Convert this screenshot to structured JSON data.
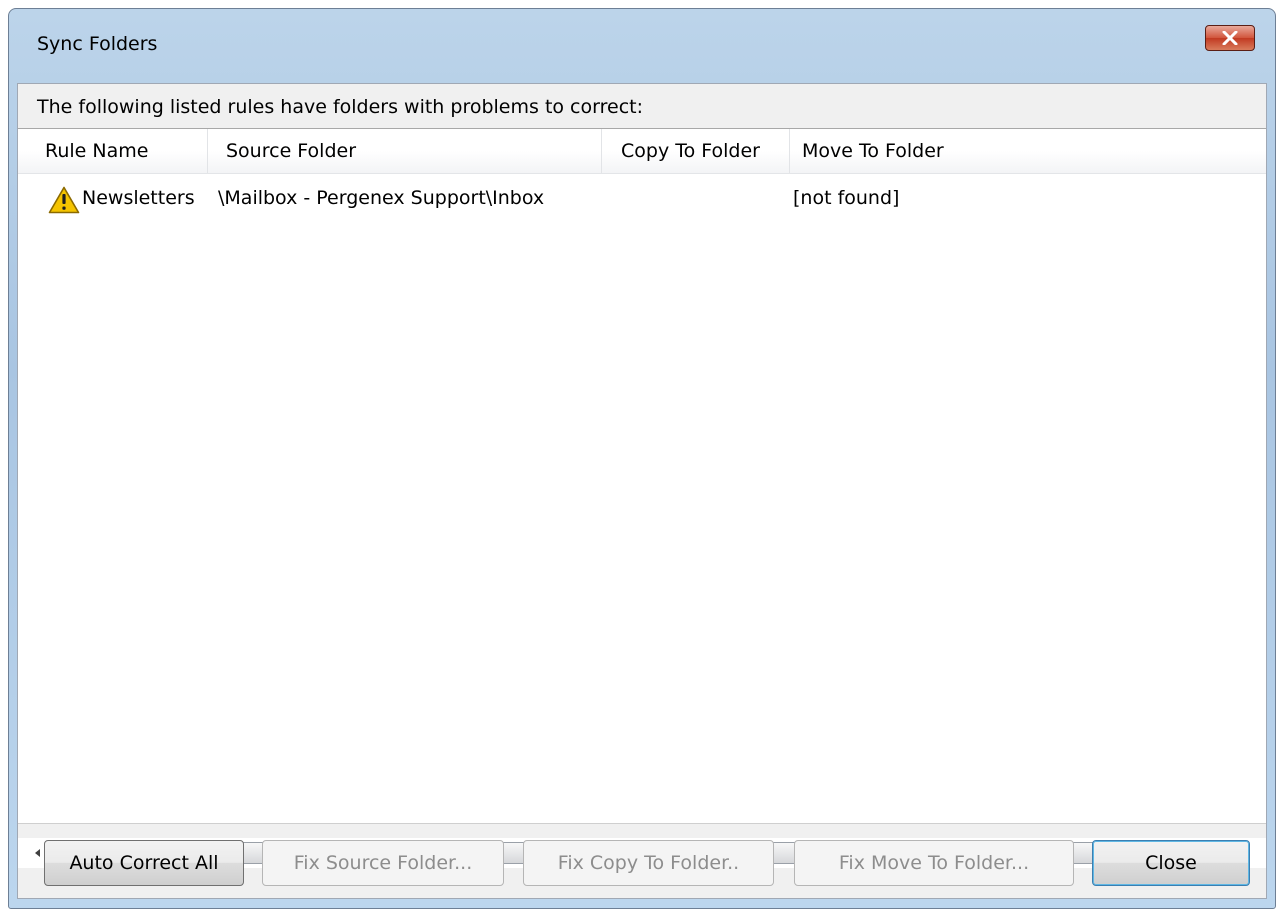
{
  "window": {
    "title": "Sync Folders"
  },
  "prompt": "The following listed rules have folders with problems to correct:",
  "table": {
    "columns": [
      "Rule Name",
      "Source Folder",
      "Copy To Folder",
      "Move To Folder"
    ],
    "rows": [
      {
        "icon": "warning-icon",
        "rule_name": "Newsletters",
        "source_folder": "\\Mailbox - Pergenex Support\\Inbox",
        "copy_to_folder": "",
        "move_to_folder": "[not found]"
      }
    ]
  },
  "scrollbar": {
    "grip": "III"
  },
  "buttons": {
    "auto_correct_all": "Auto Correct All",
    "fix_source_folder": "Fix Source Folder...",
    "fix_copy_to_folder": "Fix Copy  To Folder..",
    "fix_move_to_folder": "Fix Move To Folder...",
    "close": "Close"
  },
  "colors": {
    "title_bar": "#b9d1ea",
    "close_button": "#c94a32",
    "warning": "#f5c400"
  }
}
